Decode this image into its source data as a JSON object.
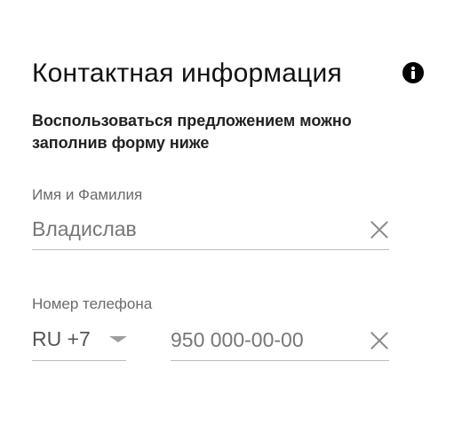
{
  "form": {
    "title": "Контактная информация",
    "info_icon": "info-icon",
    "subtitle": "Воспользоваться предложением можно заполнив форму ниже",
    "name_field": {
      "label": "Имя и Фамилия",
      "value": "Владислав",
      "placeholder": "Владислав"
    },
    "phone_field": {
      "label": "Номер телефона",
      "country_code": "RU +7",
      "value": "",
      "placeholder": "950 000-00-00"
    },
    "clear_icon": "close-icon"
  }
}
